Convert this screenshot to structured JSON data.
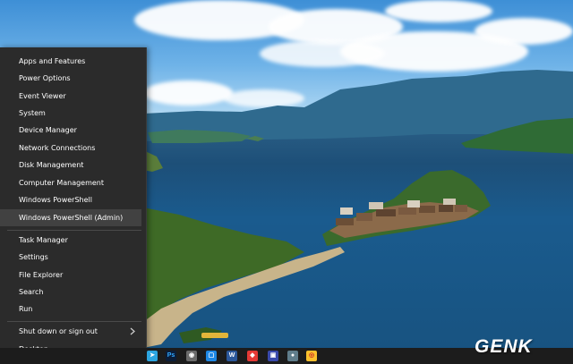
{
  "menu": {
    "items": [
      {
        "label": "Apps and Features",
        "name": "menu-item-apps-and-features"
      },
      {
        "label": "Power Options",
        "name": "menu-item-power-options"
      },
      {
        "label": "Event Viewer",
        "name": "menu-item-event-viewer"
      },
      {
        "label": "System",
        "name": "menu-item-system"
      },
      {
        "label": "Device Manager",
        "name": "menu-item-device-manager"
      },
      {
        "label": "Network Connections",
        "name": "menu-item-network-connections"
      },
      {
        "label": "Disk Management",
        "name": "menu-item-disk-management"
      },
      {
        "label": "Computer Management",
        "name": "menu-item-computer-management"
      },
      {
        "label": "Windows PowerShell",
        "name": "menu-item-windows-powershell"
      },
      {
        "label": "Windows PowerShell (Admin)",
        "name": "menu-item-windows-powershell-admin"
      },
      {
        "label": "Task Manager",
        "name": "menu-item-task-manager"
      },
      {
        "label": "Settings",
        "name": "menu-item-settings"
      },
      {
        "label": "File Explorer",
        "name": "menu-item-file-explorer"
      },
      {
        "label": "Search",
        "name": "menu-item-search"
      },
      {
        "label": "Run",
        "name": "menu-item-run"
      },
      {
        "label": "Shut down or sign out",
        "name": "menu-item-shut-down-or-sign-out"
      },
      {
        "label": "Desktop",
        "name": "menu-item-desktop"
      }
    ],
    "highlighted_index": 9,
    "background": "#2b2b2b",
    "highlight": "#414141"
  },
  "taskbar": {
    "icons": [
      {
        "name": "telegram-icon",
        "glyph": "➤",
        "color": "#2ca5e0"
      },
      {
        "name": "photoshop-icon",
        "glyph": "Ps",
        "color": "#0b1d38"
      },
      {
        "name": "app-icon-1",
        "glyph": "◉",
        "color": "#6b6b6b"
      },
      {
        "name": "app-icon-2",
        "glyph": "▢",
        "color": "#1e88e5"
      },
      {
        "name": "word-icon",
        "glyph": "W",
        "color": "#2b579a"
      },
      {
        "name": "app-icon-3",
        "glyph": "◆",
        "color": "#e53935"
      },
      {
        "name": "app-icon-4",
        "glyph": "▣",
        "color": "#3949ab"
      },
      {
        "name": "app-icon-5",
        "glyph": "●",
        "color": "#607d8b"
      },
      {
        "name": "messenger-icon",
        "glyph": "✉",
        "color": "#0084ff"
      },
      {
        "name": "chrome-icon",
        "glyph": "◎",
        "color": "#fbc02d"
      }
    ]
  },
  "watermark": {
    "text": "GENK"
  }
}
